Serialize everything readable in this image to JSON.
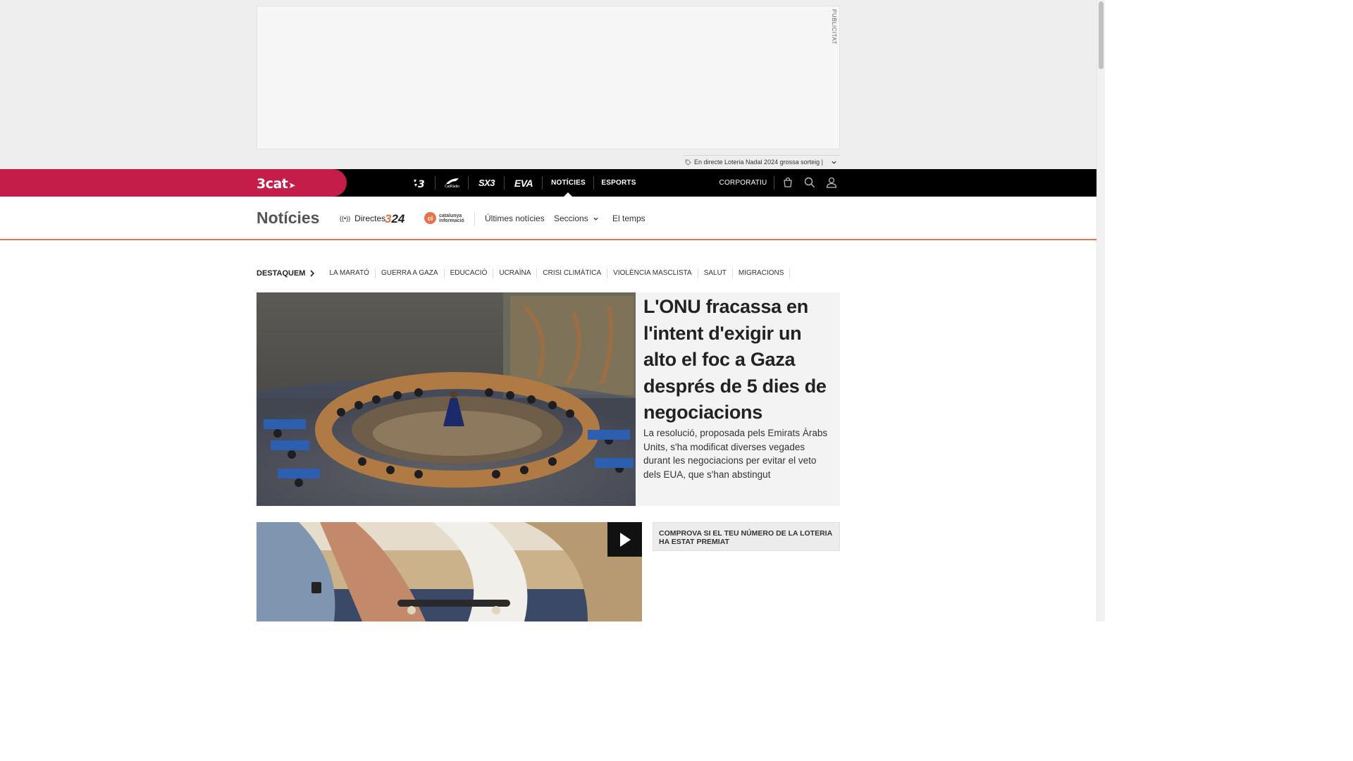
{
  "ad": {
    "label": "PUBLICITAT",
    "ticker_text": "En directe Loteria Nadal 2024 grossa sorteig |"
  },
  "topnav": {
    "brand": "3cat",
    "channels": [
      {
        "name": "3-icon"
      },
      {
        "name": "catradio-icon",
        "label": "CatRàdio"
      },
      {
        "name": "sx3-icon",
        "label": "SX3"
      },
      {
        "name": "eva-icon",
        "label": "EVA"
      }
    ],
    "links": {
      "noticies": "NOTÍCIES",
      "esports": "ESPORTS",
      "corporatiu": "CORPORATIU"
    }
  },
  "section": {
    "title": "Notícies",
    "directes": "Directes",
    "logo324": "324",
    "ci_line1": "catalunya",
    "ci_line2": "informació",
    "nav": {
      "ultimes": "Últimes notícies",
      "seccions": "Seccions",
      "temps": "El temps"
    }
  },
  "featured": {
    "lead": "DESTAQUEM",
    "tags": [
      "LA MARATÓ",
      "GUERRA A GAZA",
      "EDUCACIÓ",
      "UCRAÏNA",
      "CRISI CLIMÀTICA",
      "VIOLÈNCIA MASCLISTA",
      "SALUT",
      "MIGRACIONS"
    ]
  },
  "hero": {
    "title": "L'ONU fracassa en l'intent d'exigir un alto el foc a Gaza després de 5 dies de negociacions",
    "subtitle": "La resolució, proposada pels Emirats Àrabs Units, s'ha modificat diverses vegades durant les negociacions per evitar el veto dels EUA, que s'han abstingut"
  },
  "lottery": {
    "text": "COMPROVA SI EL TEU NÚMERO DE LA LOTERIA HA ESTAT PREMIAT"
  },
  "colors": {
    "brand": "#c51d4a",
    "accent": "#e8734a",
    "nav": "#000000"
  }
}
